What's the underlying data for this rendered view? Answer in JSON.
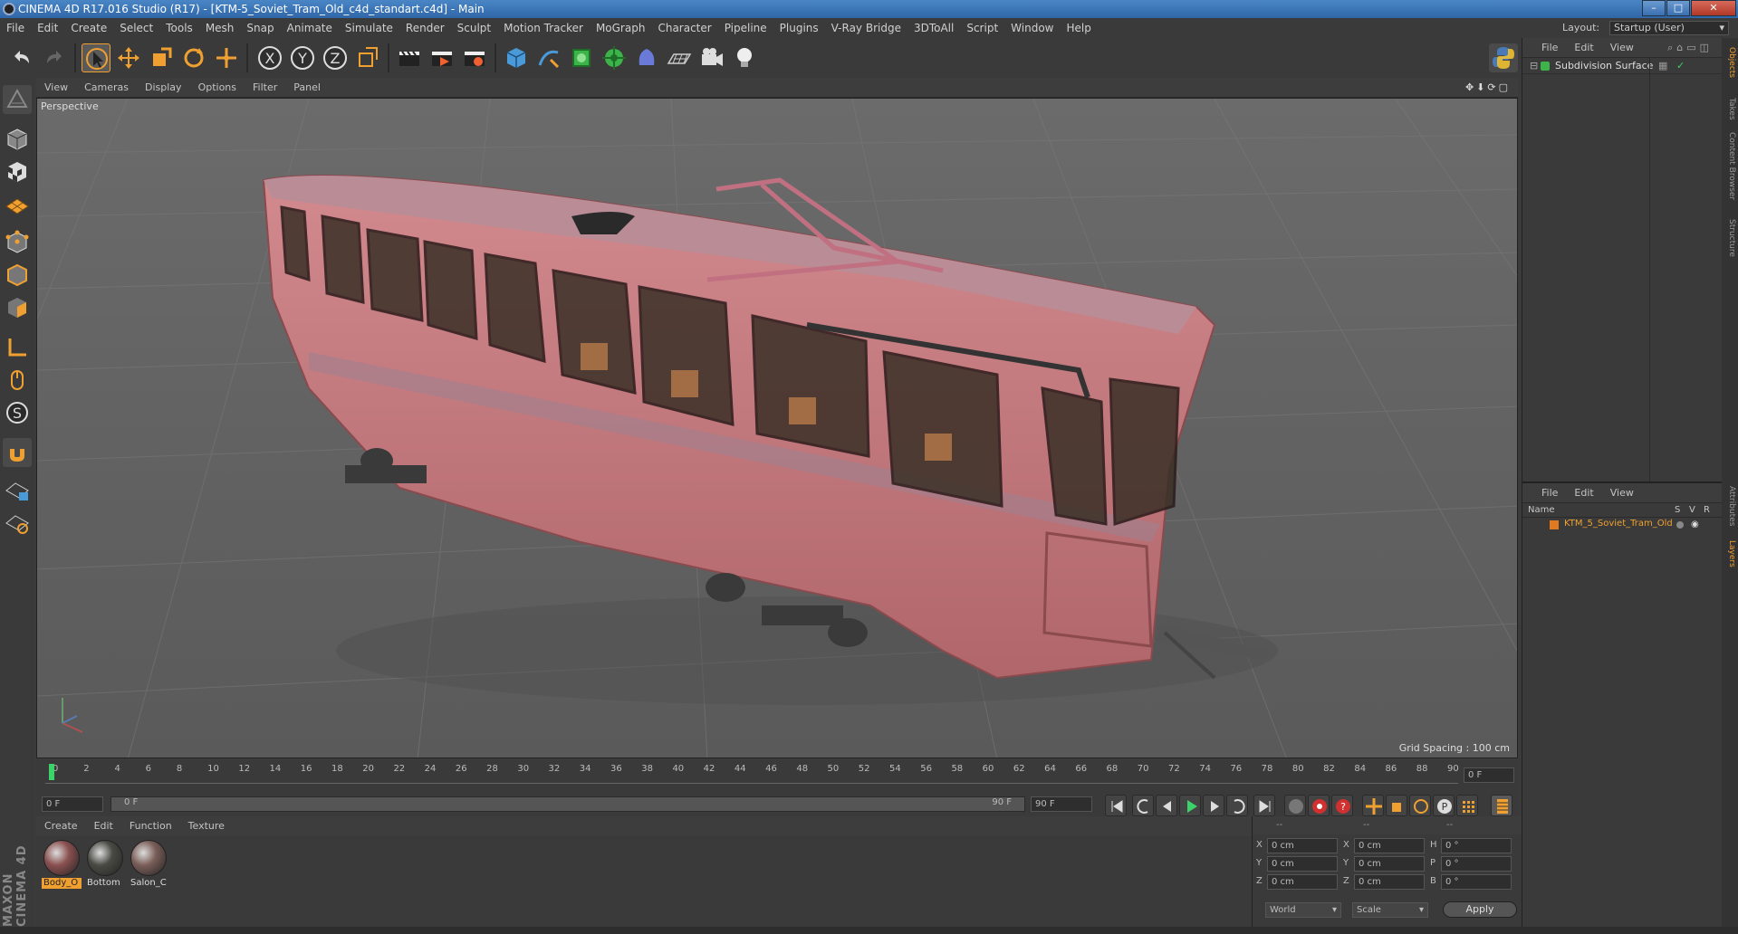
{
  "window": {
    "title": "CINEMA 4D R17.016 Studio (R17) - [KTM-5_Soviet_Tram_Old_c4d_standart.c4d] - Main"
  },
  "menubar": {
    "items": [
      "File",
      "Edit",
      "Create",
      "Select",
      "Tools",
      "Mesh",
      "Snap",
      "Animate",
      "Simulate",
      "Render",
      "Sculpt",
      "Motion Tracker",
      "MoGraph",
      "Character",
      "Pipeline",
      "Plugins",
      "V-Ray Bridge",
      "3DToAll",
      "Script",
      "Window",
      "Help"
    ],
    "layout_label": "Layout:",
    "layout_value": "Startup (User)"
  },
  "viewport": {
    "menu": [
      "View",
      "Cameras",
      "Display",
      "Options",
      "Filter",
      "Panel"
    ],
    "label": "Perspective",
    "grid_spacing": "Grid Spacing : 100 cm"
  },
  "timeline": {
    "ticks": [
      "0",
      "2",
      "4",
      "6",
      "8",
      "10",
      "12",
      "14",
      "16",
      "18",
      "20",
      "22",
      "24",
      "26",
      "28",
      "30",
      "32",
      "34",
      "36",
      "38",
      "40",
      "42",
      "44",
      "46",
      "48",
      "50",
      "52",
      "54",
      "56",
      "58",
      "60",
      "62",
      "64",
      "66",
      "68",
      "70",
      "72",
      "74",
      "76",
      "78",
      "80",
      "82",
      "84",
      "86",
      "88",
      "90"
    ],
    "current_frame": "0 F",
    "start_frame": "0 F",
    "range_start": "0 F",
    "range_end": "90 F",
    "end_frame": "90 F"
  },
  "materials": {
    "menu": [
      "Create",
      "Edit",
      "Function",
      "Texture"
    ],
    "items": [
      {
        "label": "Body_O",
        "color": "#8a5050"
      },
      {
        "label": "Bottom",
        "color": "#4a4a44"
      },
      {
        "label": "Salon_C",
        "color": "#7a5e58"
      }
    ]
  },
  "coords": {
    "header": [
      "--",
      "--",
      "--"
    ],
    "rows": [
      {
        "a": "X",
        "av": "0 cm",
        "b": "X",
        "bv": "0 cm",
        "c": "H",
        "cv": "0 °"
      },
      {
        "a": "Y",
        "av": "0 cm",
        "b": "Y",
        "bv": "0 cm",
        "c": "P",
        "cv": "0 °"
      },
      {
        "a": "Z",
        "av": "0 cm",
        "b": "Z",
        "bv": "0 cm",
        "c": "B",
        "cv": "0 °"
      }
    ],
    "mode1": "World",
    "mode2": "Scale",
    "apply": "Apply"
  },
  "objects": {
    "menu": [
      "File",
      "Edit",
      "View"
    ],
    "items": [
      {
        "name": "Subdivision Surface"
      }
    ]
  },
  "layers": {
    "menu": [
      "File",
      "Edit",
      "View"
    ],
    "columns": [
      "Name",
      "S",
      "V",
      "R"
    ],
    "items": [
      {
        "name": "KTM_5_Soviet_Tram_Old"
      }
    ]
  },
  "side_tabs": [
    "Objects",
    "Takes",
    "Content Browser",
    "Structure",
    "Attributes",
    "Layers"
  ],
  "branding": {
    "logo": "MAXON CINEMA 4D"
  },
  "colors": {
    "accent": "#f0a030",
    "title": "#3a72b5",
    "viewport": "#636363",
    "tram": "#c8787c"
  }
}
